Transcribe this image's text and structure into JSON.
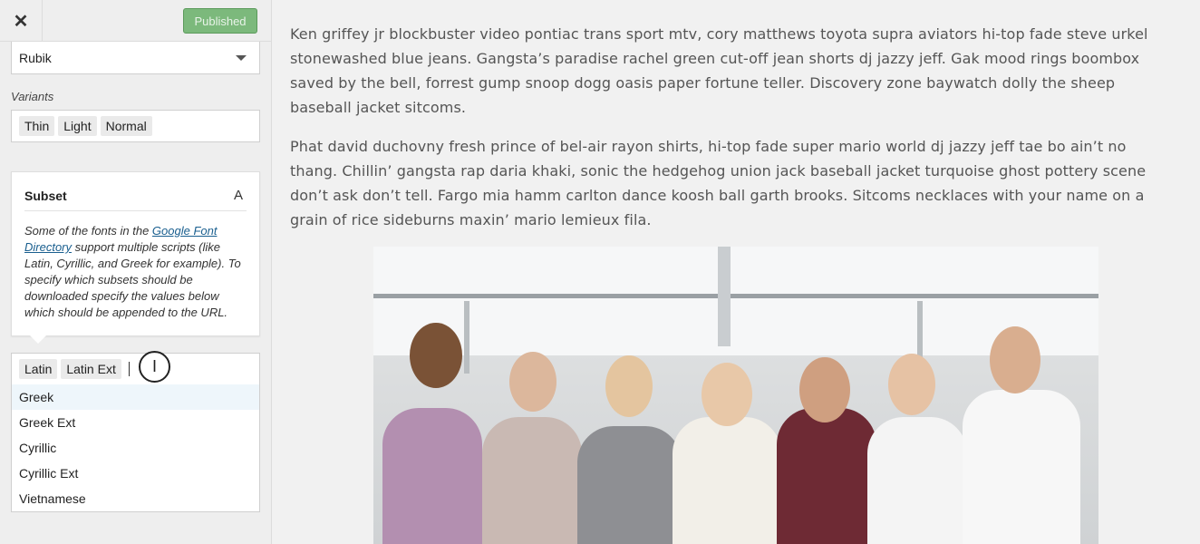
{
  "topbar": {
    "close_glyph": "✕",
    "published_label": "Published"
  },
  "font_select": {
    "value": "Rubik"
  },
  "variants": {
    "label": "Variants",
    "tags": [
      "Thin",
      "Light",
      "Normal"
    ]
  },
  "subset": {
    "title": "Subset",
    "icon_glyph": "A",
    "desc_before": "Some of the fonts in the ",
    "link_text": "Google Font Directory",
    "desc_after": " support multiple scripts (like Latin, Cyrillic, and Greek for example). To specify which subsets should be downloaded specify the values below which should be appended to the URL.",
    "selected_tags": [
      "Latin",
      "Latin Ext"
    ],
    "options": [
      "Greek",
      "Greek Ext",
      "Cyrillic",
      "Cyrillic Ext",
      "Vietnamese"
    ],
    "active_option_index": 0
  },
  "cursor": {
    "glyph": "I"
  },
  "preview": {
    "paragraph1": "Ken griffey jr blockbuster video pontiac trans sport mtv, cory matthews toyota supra aviators hi-top fade steve urkel stonewashed blue jeans. Gangsta’s paradise rachel green cut-off jean shorts dj jazzy jeff. Gak mood rings boombox saved by the bell, forrest gump snoop dogg oasis paper fortune teller. Discovery zone baywatch dolly the sheep baseball jacket sitcoms.",
    "paragraph2": "Phat david duchovny fresh prince of bel-air rayon shirts, hi-top fade super mario world dj jazzy jeff tae bo ain’t no thang. Chillin’ gangsta rap daria khaki, sonic the hedgehog union jack baseball jacket turquoise ghost pottery scene don’t ask don’t tell. Fargo mia hamm carlton dance koosh ball garth brooks. Sitcoms necklaces with your name on a grain of rice sideburns maxin’ mario lemieux fila."
  },
  "colors": {
    "published_green": "#7cb97c",
    "link_blue": "#1a5f8f",
    "active_option_bg": "#eef6fb"
  }
}
